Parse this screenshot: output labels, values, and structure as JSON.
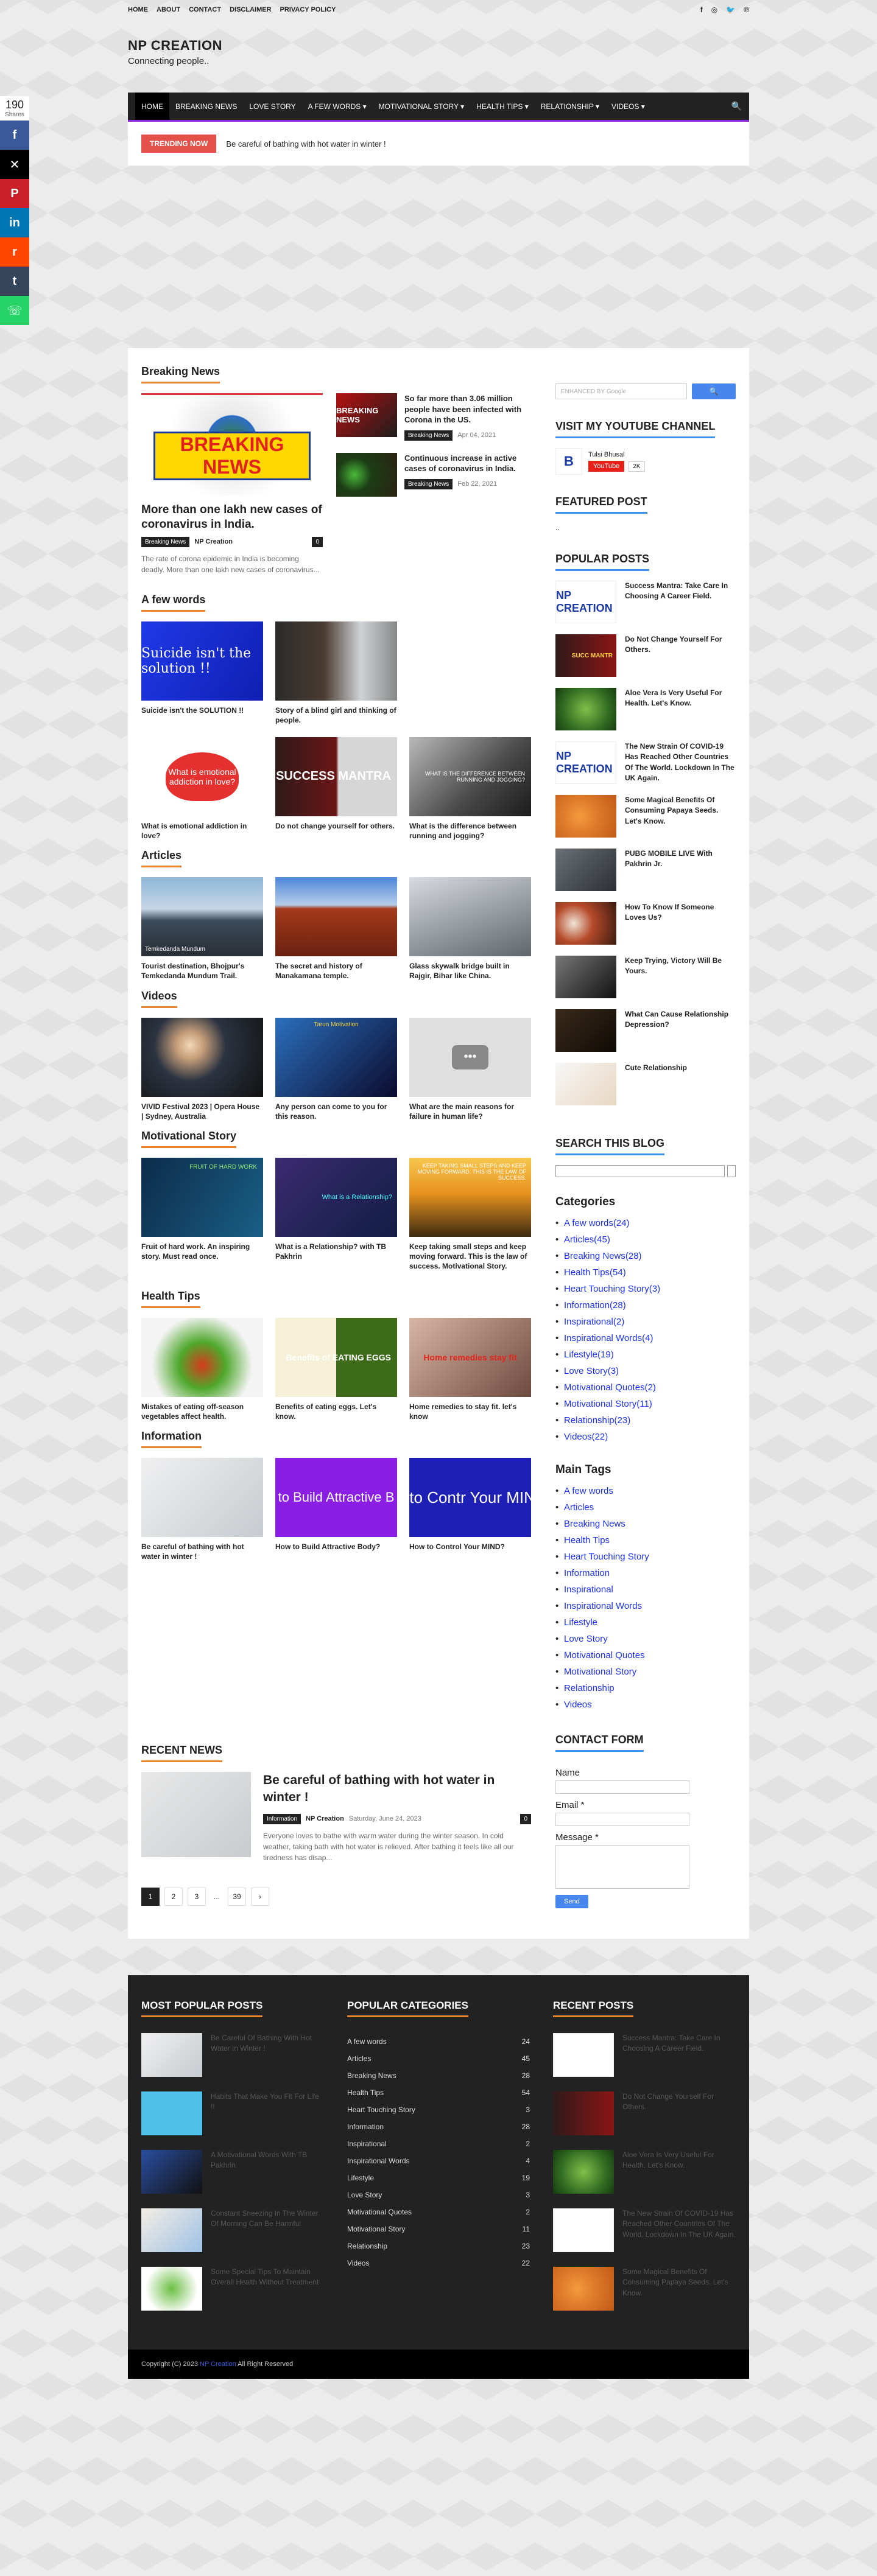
{
  "topbar": {
    "links": [
      "HOME",
      "ABOUT",
      "CONTACT",
      "DISCLAIMER",
      "PRIVACY POLICY"
    ],
    "social_icons": [
      "facebook-icon",
      "instagram-icon",
      "twitter-icon",
      "pinterest-icon"
    ]
  },
  "site": {
    "title": "NP CREATION",
    "tagline": "Connecting people.."
  },
  "nav": {
    "items": [
      "HOME",
      "BREAKING NEWS",
      "LOVE STORY",
      "A FEW WORDS ▾",
      "MOTIVATIONAL STORY ▾",
      "HEALTH TIPS ▾",
      "RELATIONSHIP ▾",
      "VIDEOS ▾"
    ],
    "search_icon": "🔍"
  },
  "trending": {
    "label": "TRENDING NOW",
    "text": "Be careful of bathing with hot water in winter !"
  },
  "share": {
    "count": "190",
    "label": "Shares",
    "buttons": [
      "f",
      "✕",
      "P",
      "in",
      "r",
      "t",
      "☏"
    ]
  },
  "breaking": {
    "title": "Breaking News",
    "main": {
      "image_label": "BREAKING NEWS",
      "title": "More than one lakh new cases of coronavirus in India.",
      "label": "Breaking News",
      "author": "NP Creation",
      "comments": "0",
      "excerpt": "The rate of corona epidemic in India is becoming deadly. More than one lakh new cases of coronavirus..."
    },
    "side": [
      {
        "img_text": "BREAKING NEWS",
        "title": "So far more than 3.06 million people have been infected with Corona in the US.",
        "label": "Breaking News",
        "date": "Apr 04, 2021"
      },
      {
        "img_text": "",
        "title": "Continuous increase in active cases of coronavirus in India.",
        "label": "Breaking News",
        "date": "Feb 22, 2021"
      }
    ]
  },
  "few_words": {
    "title": "A few words",
    "cards": [
      {
        "img_text": "Suicide isn't the solution !!",
        "title": "Suicide isn't the SOLUTION !!"
      },
      {
        "img_text": "",
        "title": "Story of a blind girl and thinking of people."
      },
      {
        "img_text": "What is emotional addiction in love?",
        "title": "What is emotional addiction in love?"
      },
      {
        "img_text": "SUCCESS MANTRA",
        "title": "Do not change yourself for others."
      },
      {
        "img_text": "WHAT IS THE DIFFERENCE BETWEEN RUNNING AND JOGGING?",
        "title": "What is the difference between running and jogging?"
      }
    ]
  },
  "articles": {
    "title": "Articles",
    "cards": [
      {
        "img_text": "Temkedanda Mundum",
        "title": "Tourist destination, Bhojpur's Temkedanda Mundum Trail."
      },
      {
        "img_text": "",
        "title": "The secret and history of Manakamana temple."
      },
      {
        "img_text": "",
        "title": "Glass skywalk bridge built in Rajgir, Bihar like China."
      }
    ]
  },
  "videos": {
    "title": "Videos",
    "cards": [
      {
        "img_text": "",
        "title": "VIVID Festival 2023 | Opera House | Sydney, Australia"
      },
      {
        "img_text": "Tarun Motivation",
        "title": "Any person can come to you for this reason."
      },
      {
        "img_text": "•••",
        "title": "What are the main reasons for failure in human life?"
      }
    ]
  },
  "motivational": {
    "title": "Motivational Story",
    "cards": [
      {
        "img_text": "FRUIT OF HARD WORK",
        "title": "Fruit of hard work. An inspiring story. Must read once."
      },
      {
        "img_text": "What is a Relationship?",
        "title": "What is a Relationship? with TB Pakhrin"
      },
      {
        "img_text": "KEEP TAKING SMALL STEPS AND KEEP MOVING FORWARD. THIS IS THE LAW OF SUCCESS.",
        "title": "Keep taking small steps and keep moving forward. This is the law of success. Motivational Story."
      }
    ]
  },
  "health": {
    "title": "Health Tips",
    "cards": [
      {
        "img_text": "",
        "title": "Mistakes of eating off-season vegetables affect health."
      },
      {
        "img_text": "Benefits of EATING EGGS",
        "title": "Benefits of eating eggs. Let's know."
      },
      {
        "img_text": "Home remedies stay fit",
        "title": "Home remedies to stay fit. let's know"
      }
    ]
  },
  "information": {
    "title": "Information",
    "cards": [
      {
        "img_text": "",
        "title": "Be careful of bathing with hot water in winter !"
      },
      {
        "img_text": "to Build Attractive B",
        "title": "How to Build Attractive Body?"
      },
      {
        "img_text": "w to Contr Your MIND",
        "title": "How to Control Your MIND?"
      }
    ]
  },
  "recent": {
    "title": "RECENT NEWS",
    "item": {
      "title": "Be careful of bathing with hot water in winter !",
      "label": "Information",
      "author": "NP Creation",
      "date": "Saturday, June 24, 2023",
      "comments": "0",
      "excerpt": "Everyone loves to bathe with warm water during the winter season. In cold weather, taking bath with hot water is relieved. After bathing it feels like all our tiredness has disap..."
    },
    "pager": [
      "1",
      "2",
      "3",
      "...",
      "39",
      "›"
    ]
  },
  "sidebar": {
    "search_placeholder": "ENHANCED BY Google",
    "search_button": "🔍",
    "youtube": {
      "title": "VISIT MY YOUTUBE CHANNEL",
      "channel": "Tulsi Bhusal",
      "button": "YouTube",
      "count": "2K"
    },
    "featured_title": "FEATURED POST",
    "featured_text": "..",
    "popular_title": "POPULAR POSTS",
    "popular": [
      {
        "img_text": "NP CREATION",
        "title": "Success Mantra: Take Care In Choosing A Career Field."
      },
      {
        "img_text": "SUCC MANTR",
        "title": "Do Not Change Yourself For Others."
      },
      {
        "img_text": "",
        "title": "Aloe Vera Is Very Useful For Health. Let's Know."
      },
      {
        "img_text": "NP CREATION",
        "title": "The New Strain Of COVID-19 Has Reached Other Countries Of The World. Lockdown In The UK Again."
      },
      {
        "img_text": "",
        "title": "Some Magical Benefits Of Consuming Papaya Seeds. Let's Know."
      },
      {
        "img_text": "",
        "title": "PUBG MOBILE LIVE With Pakhrin Jr."
      },
      {
        "img_text": "",
        "title": "How To Know If Someone Loves Us?"
      },
      {
        "img_text": "",
        "title": "Keep Trying, Victory Will Be Yours."
      },
      {
        "img_text": "",
        "title": "What Can Cause Relationship Depression?"
      },
      {
        "img_text": "",
        "title": "Cute Relationship"
      }
    ],
    "search_blog_title": "SEARCH THIS BLOG",
    "categories_title": "Categories",
    "categories": [
      "A few words(24)",
      "Articles(45)",
      "Breaking News(28)",
      "Health Tips(54)",
      "Heart Touching Story(3)",
      "Information(28)",
      "Inspirational(2)",
      "Inspirational Words(4)",
      "Lifestyle(19)",
      "Love Story(3)",
      "Motivational Quotes(2)",
      "Motivational Story(11)",
      "Relationship(23)",
      "Videos(22)"
    ],
    "tags_title": "Main Tags",
    "tags": [
      "A few words",
      "Articles",
      "Breaking News",
      "Health Tips",
      "Heart Touching Story",
      "Information",
      "Inspirational",
      "Inspirational Words",
      "Lifestyle",
      "Love Story",
      "Motivational Quotes",
      "Motivational Story",
      "Relationship",
      "Videos"
    ],
    "contact": {
      "title": "CONTACT FORM",
      "name_label": "Name",
      "email_label": "Email *",
      "message_label": "Message *",
      "send": "Send"
    }
  },
  "footer": {
    "popular_title": "MOST POPULAR POSTS",
    "popular": [
      "Be Careful Of Bathing With Hot Water In Winter !",
      "Habits That Make You Fit For Life !!",
      "A Motivational Words With TB Pakhrin",
      "Constant Sneezing In The Winter Of Morning Can Be Harmful",
      "Some Special Tips To Maintain Overall Health Without Treatment"
    ],
    "categories_title": "POPULAR CATEGORIES",
    "categories": [
      {
        "name": "A few words",
        "count": "24"
      },
      {
        "name": "Articles",
        "count": "45"
      },
      {
        "name": "Breaking News",
        "count": "28"
      },
      {
        "name": "Health Tips",
        "count": "54"
      },
      {
        "name": "Heart Touching Story",
        "count": "3"
      },
      {
        "name": "Information",
        "count": "28"
      },
      {
        "name": "Inspirational",
        "count": "2"
      },
      {
        "name": "Inspirational Words",
        "count": "4"
      },
      {
        "name": "Lifestyle",
        "count": "19"
      },
      {
        "name": "Love Story",
        "count": "3"
      },
      {
        "name": "Motivational Quotes",
        "count": "2"
      },
      {
        "name": "Motivational Story",
        "count": "11"
      },
      {
        "name": "Relationship",
        "count": "23"
      },
      {
        "name": "Videos",
        "count": "22"
      }
    ],
    "recent_title": "RECENT POSTS",
    "recent": [
      "Success Mantra: Take Care In Choosing A Career Field.",
      "Do Not Change Yourself For Others.",
      "Aloe Vera Is Very Useful For Health. Let's Know.",
      "The New Strain Of COVID-19 Has Reached Other Countries Of The World. Lockdown In The UK Again.",
      "Some Magical Benefits Of Consuming Papaya Seeds. Let's Know."
    ],
    "copyright_pre": "Copyright (C) 2023",
    "copyright_brand": "NP Creation",
    "copyright_post": "All Right Reserved"
  },
  "colors": {
    "accent_orange": "#e9842f",
    "accent_blue": "#3d93ec",
    "trending_red": "#e4514b",
    "nav_purple": "#8b2be2"
  }
}
